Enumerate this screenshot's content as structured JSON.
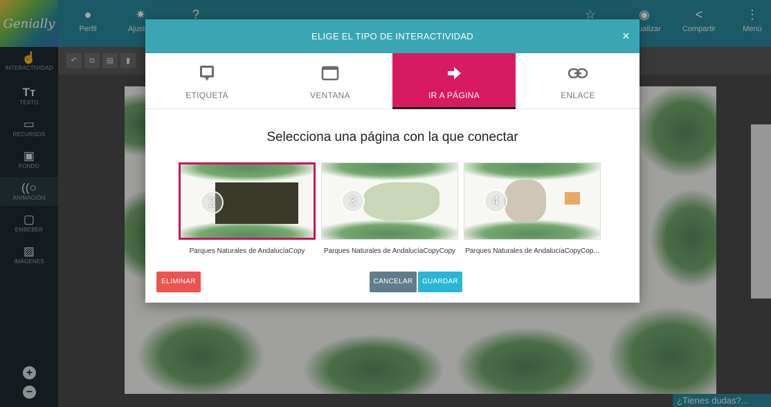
{
  "app": {
    "logo_text": "Genially"
  },
  "topbar": {
    "items": [
      {
        "label": "Perfil",
        "icon": "user-icon"
      },
      {
        "label": "Ajustes",
        "icon": "gear-icon"
      },
      {
        "label": "",
        "icon": "help-icon"
      },
      {
        "label": "",
        "icon": "star-icon"
      },
      {
        "label": "Visualizar",
        "icon": "eye-icon"
      },
      {
        "label": "Compartir",
        "icon": "share-icon"
      },
      {
        "label": "Menú",
        "icon": "menu-icon"
      }
    ]
  },
  "sidebar": {
    "items": [
      {
        "label": "INTERACTIVIDAD",
        "icon": "touch-icon"
      },
      {
        "label": "TEXTO",
        "icon": "text-icon"
      },
      {
        "label": "RECURSOS",
        "icon": "resources-icon"
      },
      {
        "label": "FONDO",
        "icon": "background-icon"
      },
      {
        "label": "ANIMACIÓN",
        "icon": "animation-icon"
      },
      {
        "label": "EMBEBER",
        "icon": "embed-icon"
      },
      {
        "label": "IMÁGENES",
        "icon": "image-icon"
      }
    ],
    "zoom_in": "+",
    "zoom_out": "−"
  },
  "modal": {
    "title": "ELIGE EL TIPO DE INTERACTIVIDAD",
    "close": "×",
    "tabs": [
      {
        "label": "ETIQUETA",
        "icon": "tooltip-icon"
      },
      {
        "label": "VENTANA",
        "icon": "window-icon"
      },
      {
        "label": "IR A PÁGINA",
        "icon": "arrow-right-icon",
        "active": true
      },
      {
        "label": "ENLACE",
        "icon": "link-icon"
      }
    ],
    "heading": "Selecciona una página con la que conectar",
    "pages": [
      {
        "number": "2",
        "caption": "Parques Naturales de AndalucíaCopy",
        "selected": true
      },
      {
        "number": "3",
        "caption": "Parques Naturales de AndalucíaCopyCopy",
        "selected": false
      },
      {
        "number": "4",
        "caption": "Parques Naturales de AndalucíaCopyCop...",
        "selected": false
      }
    ],
    "buttons": {
      "delete": "ELIMINAR",
      "cancel": "CANCELAR",
      "save": "GUARDAR"
    }
  },
  "help": {
    "label": "¿Tienes dudas?..."
  },
  "colors": {
    "topbar": "#2a8a9a",
    "modal_header": "#3aa6b4",
    "active_tab": "#d81b60",
    "delete": "#ef5350",
    "cancel": "#607d8b",
    "save": "#29b6d6"
  }
}
